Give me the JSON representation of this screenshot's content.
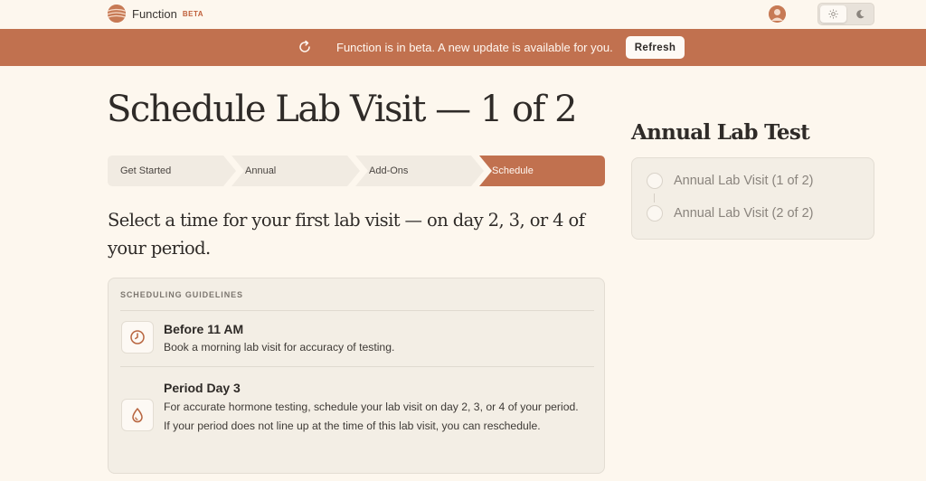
{
  "nav": {
    "brand_name": "Function",
    "brand_badge": "BETA",
    "avatar_icon": "user-avatar",
    "theme_light_icon": "sun-icon",
    "theme_dark_icon": "moon-icon"
  },
  "banner": {
    "icon": "refresh-icon",
    "message": "Function is in beta. A new update is available for you.",
    "button_label": "Refresh"
  },
  "page": {
    "title": "Schedule Lab Visit — 1 of 2",
    "subtitle": "Select a time for your first lab visit — on day 2, 3, or 4 of your period."
  },
  "stepper": {
    "steps": [
      {
        "label": "Get Started",
        "state": "complete"
      },
      {
        "label": "Annual",
        "state": "complete"
      },
      {
        "label": "Add-Ons",
        "state": "complete"
      },
      {
        "label": "Schedule",
        "state": "active"
      }
    ]
  },
  "guidelines": {
    "label": "SCHEDULING GUIDELINES",
    "items": [
      {
        "icon": "clock-icon",
        "title": "Before 11 AM",
        "description": "Book a morning lab visit for accuracy of testing."
      },
      {
        "icon": "droplet-icon",
        "title": "Period Day 3",
        "description": "For accurate hormone testing, schedule your lab visit on day 2, 3, or 4 of your period. If your period does not line up at the time of this lab visit, you can reschedule."
      }
    ]
  },
  "side": {
    "title": "Annual Lab Test",
    "visits": [
      {
        "label": "Annual Lab Visit (1 of 2)"
      },
      {
        "label": "Annual Lab Visit (2 of 2)"
      }
    ]
  },
  "colors": {
    "accent": "#c1714f",
    "background": "#fdf7ee",
    "card": "#f3eee5"
  }
}
